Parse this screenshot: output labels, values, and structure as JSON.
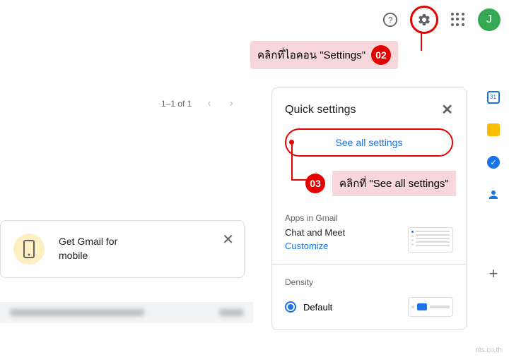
{
  "header": {
    "avatar_letter": "J"
  },
  "callouts": {
    "step02": {
      "badge": "02",
      "text": "คลิกที่ไอคอน \"Settings\""
    },
    "step03": {
      "badge": "03",
      "text": "คลิกที่ \"See all settings\""
    }
  },
  "message_list": {
    "pagination": "1–1 of 1",
    "promo": {
      "line1": "Get Gmail for",
      "line2": "mobile"
    }
  },
  "quick_settings": {
    "title": "Quick settings",
    "see_all": "See all settings",
    "sections": {
      "apps_label": "Apps in Gmail",
      "chat_meet": "Chat and Meet",
      "customize": "Customize",
      "density_label": "Density",
      "density_default": "Default"
    }
  },
  "watermark": "nts.co.th"
}
